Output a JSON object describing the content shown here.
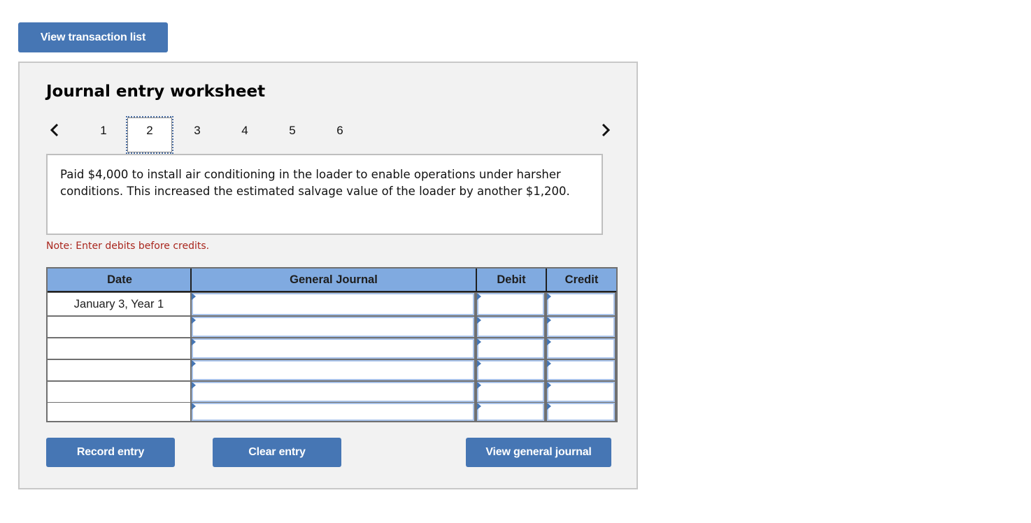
{
  "top_button": {
    "label": "View transaction list"
  },
  "worksheet": {
    "title": "Journal entry worksheet",
    "nav": {
      "prev_icon": "chevron-left-icon",
      "next_icon": "chevron-right-icon",
      "tabs": [
        "1",
        "2",
        "3",
        "4",
        "5",
        "6"
      ],
      "active_tab": "2"
    },
    "description": "Paid $4,000 to install air conditioning in the loader to enable operations under harsher conditions. This increased the estimated salvage value of the loader by another $1,200.",
    "note": "Note: Enter debits before credits.",
    "table": {
      "headers": {
        "date": "Date",
        "general_journal": "General Journal",
        "debit": "Debit",
        "credit": "Credit"
      },
      "rows": [
        {
          "date": "January 3, Year 1",
          "account": "",
          "debit": "",
          "credit": ""
        },
        {
          "date": "",
          "account": "",
          "debit": "",
          "credit": ""
        },
        {
          "date": "",
          "account": "",
          "debit": "",
          "credit": ""
        },
        {
          "date": "",
          "account": "",
          "debit": "",
          "credit": ""
        },
        {
          "date": "",
          "account": "",
          "debit": "",
          "credit": ""
        },
        {
          "date": "",
          "account": "",
          "debit": "",
          "credit": ""
        }
      ]
    },
    "buttons": {
      "record": "Record entry",
      "clear": "Clear entry",
      "view_journal": "View general journal"
    }
  },
  "colors": {
    "button_blue": "#4676b4",
    "header_blue": "#80aae0",
    "note_red": "#a9261d",
    "panel_bg": "#f2f2f2"
  }
}
